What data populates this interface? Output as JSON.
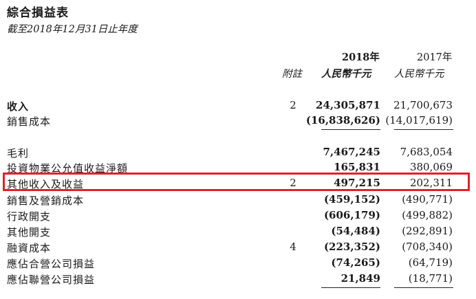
{
  "document": {
    "title": "綜合損益表",
    "subtitle": "截至2018年12月31日止年度"
  },
  "header": {
    "year_2018": "2018年",
    "year_2017": "2017年",
    "note_col": "附註",
    "currency_2018": "人民幣千元",
    "currency_2017": "人民幣千元"
  },
  "rows": [
    {
      "label": "收入",
      "note": "2",
      "v2018": "24,305,871",
      "v2017": "21,700,673",
      "bold_label": true
    },
    {
      "label": "銷售成本",
      "note": "",
      "v2018": "(16,838,626)",
      "v2017": "(14,017,619)",
      "bold_label": false
    },
    {
      "label": "毛利",
      "note": "",
      "v2018": "7,467,245",
      "v2017": "7,683,054",
      "bold_label": false
    },
    {
      "label": "投資物業公允值收益淨額",
      "note": "",
      "v2018": "165,831",
      "v2017": "380,069",
      "bold_label": false
    },
    {
      "label": "其他收入及收益",
      "note": "2",
      "v2018": "497,215",
      "v2017": "202,311",
      "bold_label": false
    },
    {
      "label": "銷售及營銷成本",
      "note": "",
      "v2018": "(459,152)",
      "v2017": "(490,771)",
      "bold_label": false
    },
    {
      "label": "行政開支",
      "note": "",
      "v2018": "(606,179)",
      "v2017": "(499,882)",
      "bold_label": false
    },
    {
      "label": "其他開支",
      "note": "",
      "v2018": "(54,484)",
      "v2017": "(292,891)",
      "bold_label": false
    },
    {
      "label": "融資成本",
      "note": "4",
      "v2018": "(223,352)",
      "v2017": "(708,340)",
      "bold_label": false
    },
    {
      "label": "應佔合營公司損益",
      "note": "",
      "v2018": "(74,265)",
      "v2017": "(64,719)",
      "bold_label": false
    },
    {
      "label": "應佔聯營公司損益",
      "note": "",
      "v2018": "21,849",
      "v2017": "(18,771)",
      "bold_label": false
    }
  ],
  "highlight": {
    "row_label": "其他收入及收益",
    "color": "#e2202a"
  }
}
